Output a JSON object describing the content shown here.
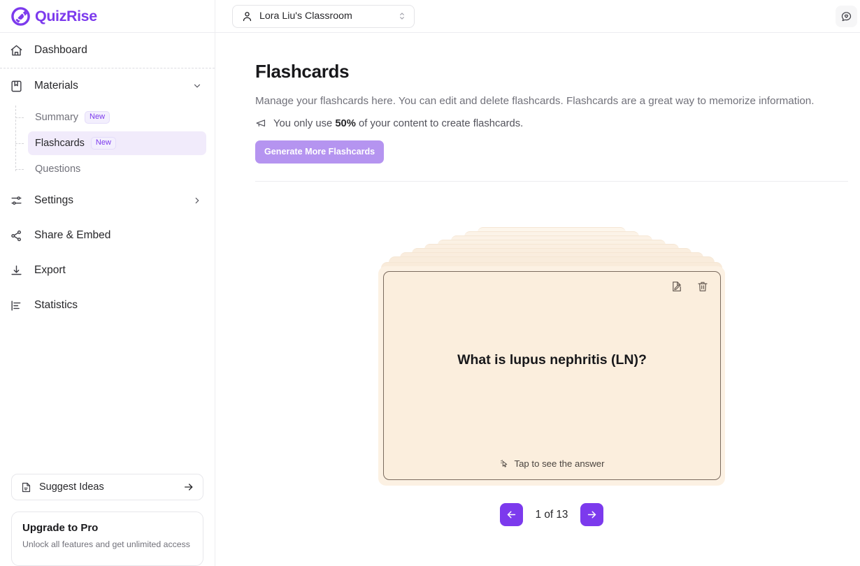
{
  "brand": {
    "name": "QuizRise",
    "logo_icon": "quizrise-logo-icon",
    "accent": "#7c3aed"
  },
  "sidebar": {
    "nav": [
      {
        "label": "Dashboard",
        "icon": "home-icon"
      },
      {
        "label": "Materials",
        "icon": "book-icon",
        "caret": "chevron-down-icon",
        "expanded": true
      }
    ],
    "sub_items": [
      {
        "label": "Summary",
        "badge": "New",
        "active": false
      },
      {
        "label": "Flashcards",
        "badge": "New",
        "active": true
      },
      {
        "label": "Questions",
        "badge": "",
        "active": false
      }
    ],
    "nav_lower": [
      {
        "label": "Settings",
        "icon": "sliders-icon",
        "caret": "chevron-right-icon"
      },
      {
        "label": "Share & Embed",
        "icon": "share-icon"
      },
      {
        "label": "Export",
        "icon": "download-icon"
      },
      {
        "label": "Statistics",
        "icon": "bar-chart-icon"
      }
    ],
    "suggest": {
      "label": "Suggest Ideas",
      "icon": "feedback-note-icon",
      "arrow": "arrow-right-icon"
    },
    "upgrade": {
      "title": "Upgrade to Pro",
      "subtitle": "Unlock all features and get unlimited access"
    }
  },
  "topbar": {
    "classroom": "Lora Liu's Classroom",
    "classroom_icon": "user-icon",
    "select_chevron": "chevrons-up-down-icon",
    "feedback_icon": "message-heart-icon",
    "avatar": "user-avatar",
    "avatar_color": "#5b21b6"
  },
  "main": {
    "title": "Flashcards",
    "description": "Manage your flashcards here. You can edit and delete flashcards. Flashcards are a great way to memorize information.",
    "notice_icon": "megaphone-icon",
    "notice_prefix": "You only use ",
    "notice_value": "50%",
    "notice_suffix": " of your content to create flashcards.",
    "generate_button": "Generate More Flashcards",
    "generate_button_color": "#b594f0"
  },
  "flashcard": {
    "question": "What is lupus nephritis (LN)?",
    "hint": "Tap to see the answer",
    "hint_icon": "cursor-sparkle-icon",
    "edit_icon": "edit-file-icon",
    "delete_icon": "trash-icon",
    "card_bg": "#fbeedd",
    "card_border": "#7a6a5d",
    "stack_layers": 9
  },
  "pager": {
    "prev_icon": "arrow-left-icon",
    "next_icon": "arrow-right-icon",
    "label": "1 of 13",
    "current": 1,
    "total": 13,
    "button_color": "#7c3aed"
  }
}
